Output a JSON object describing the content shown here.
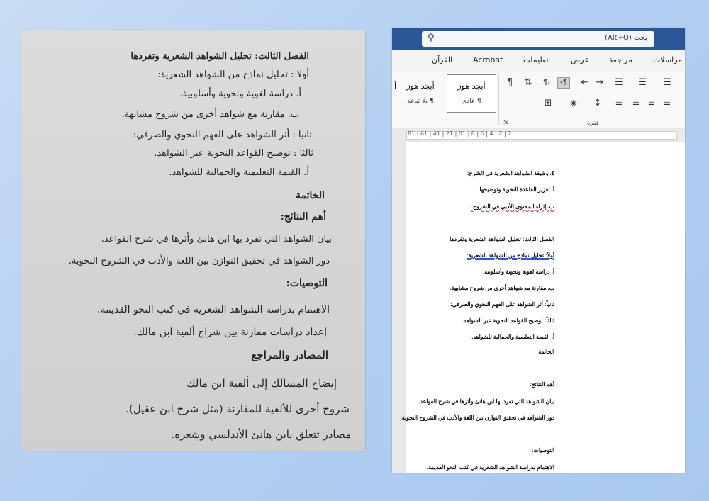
{
  "scan": {
    "lines": [
      "الفصل الثالث: تحليل الشواهد الشعرية وتفردها",
      "أولا : تحليل نماذج من الشواهد الشعرية:",
      "أ. دراسة لغوية ونحوية وأسلوبية.",
      "ب. مقارنة مع شواهد أخرى من شروح مشابهة.",
      "ثانيا : أثر الشواهد على الفهم النحوي والصرفي:",
      "ثالثا : توضيح القواعد النحوية عبر الشواهد.",
      "أ. القيمة التعليمية والجمالية للشواهد.",
      "الخاتمة",
      "أهم النتائج:",
      "بيان الشواهد التي تفرد بها ابن هانئ وأثرها في شرح القواعد.",
      "دور الشواهد في تحقيق التوازن بين اللغة والأدب في الشروح النحوية.",
      "التوصيات:",
      "الاهتمام بدراسة الشواهد الشعرية في كتب النحو القديمة.",
      "إعداد دراسات مقارنة بين شراح ألفية ابن مالك.",
      "المصادر والمراجع",
      "إيضاح المسالك إلى ألفية ابن مالك",
      "شروح أخرى للألفية للمقارنة (مثل شرح ابن عقيل).",
      "مصادر تتعلق بابن هانئ الأندلسي وشعره."
    ]
  },
  "word": {
    "search_placeholder": "بحث (Alt+Q)",
    "tabs": [
      "مراسلات",
      "مراجعة",
      "عرض",
      "تعليمات",
      "Acrobat",
      "القرآن"
    ],
    "styles": [
      {
        "preview": "أيجد هوز",
        "name": "¶ عادي"
      },
      {
        "preview": "أيجد هوز",
        "name": "¶ بلا تباعد"
      },
      {
        "preview": "أ",
        "name": ""
      }
    ],
    "paragraph_group_label": "فقرة",
    "ruler_numbers": "81 | 61 | 41 | 21 | 01 | 8 | 6 | 4 | 2 | 2",
    "doc_lines": [
      "٤. وظيفة الشواهد الشعرية في الشرح:",
      "أ. تعزيز القاعدة النحوية وتوضيحها.",
      "ب. إثراء المحتوى الأدبي في الشروح.",
      "الفصل الثالث: تحليل الشواهد الشعرية وتفردها",
      "أولاً: تحليل نماذج من الشواهد الشعرية:",
      "أ. دراسة لغوية ونحوية وأسلوبية.",
      "ب. مقارنة مع شواهد أخرى من شروح مشابهة.",
      "ثانياً: أثر الشواهد على الفهم النحوي والصرفي:",
      "ثالثاً: توضيح القواعد النحوية عبر الشواهد.",
      "أ. القيمة التعليمية والجمالية للشواهد.",
      "الخاتمة",
      "أهم النتائج:",
      "بيان الشواهد التي تفرد بها ابن هانئ وأثرها في شرح القواعد.",
      "دور الشواهد في تحقيق التوازن بين اللغة والأدب في الشروح النحوية.",
      "التوصيات:",
      "الاهتمام بدراسة الشواهد الشعرية في كتب النحو القديمة."
    ]
  },
  "colors": {
    "title_bar": "#2b579a",
    "background": "#b3cff2"
  }
}
